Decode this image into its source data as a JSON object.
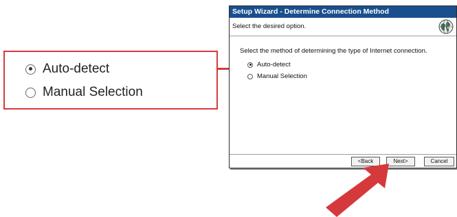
{
  "callout": {
    "options": [
      {
        "label": "Auto-detect",
        "selected": true
      },
      {
        "label": "Manual Selection",
        "selected": false
      }
    ]
  },
  "dialog": {
    "title": "Setup Wizard - Determine Connection Method",
    "subheader": "Select the desired option.",
    "prompt": "Select the method of determining the type of Internet connection.",
    "options": [
      {
        "label": "Auto-detect",
        "selected": true
      },
      {
        "label": "Manual Selection",
        "selected": false
      }
    ],
    "buttons": {
      "back": "<Back",
      "next": "Next>",
      "cancel": "Cancel"
    }
  },
  "colors": {
    "title_bar": "#1a4f8e",
    "highlight_red": "#d6393b"
  },
  "icons": {
    "header": "globe-icon",
    "pointer": "red-arrow"
  }
}
